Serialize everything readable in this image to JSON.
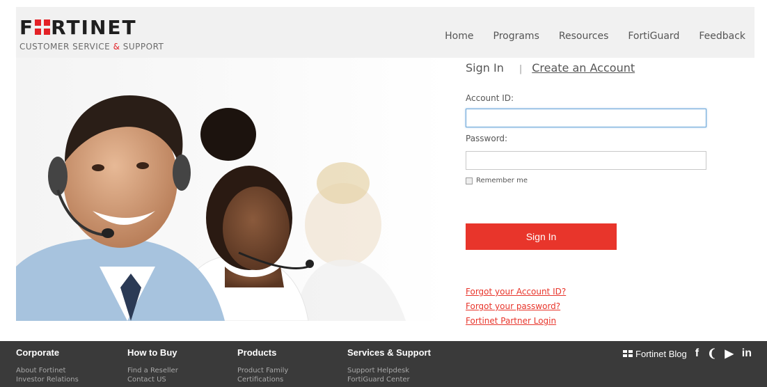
{
  "brand": {
    "logo_pre": "F",
    "logo_post": "RTINET",
    "tagline_a": "CUSTOMER SERVICE",
    "tagline_amp": "&",
    "tagline_b": "SUPPORT"
  },
  "nav": [
    "Home",
    "Programs",
    "Resources",
    "FortiGuard",
    "Feedback"
  ],
  "signin": {
    "tab_active": "Sign In",
    "separator": "|",
    "tab_create": "Create an Account",
    "account_label": "Account ID:",
    "account_value": "",
    "password_label": "Password:",
    "password_value": "",
    "remember_label": "Remember me",
    "button_label": "Sign In",
    "links": [
      "Forgot your Account ID?",
      "Forgot your password?",
      "Fortinet Partner Login"
    ]
  },
  "footer": {
    "columns": [
      {
        "title": "Corporate",
        "items": [
          "About Fortinet",
          "Investor Relations"
        ]
      },
      {
        "title": "How to Buy",
        "items": [
          "Find a Reseller",
          "Contact US"
        ]
      },
      {
        "title": "Products",
        "items": [
          "Product Family",
          "Certifications"
        ]
      },
      {
        "title": "Services & Support",
        "items": [
          "Support Helpdesk",
          "FortiGuard Center"
        ]
      }
    ],
    "blog_label": "Fortinet Blog",
    "social_icons": [
      "facebook-icon",
      "twitter-icon",
      "youtube-icon",
      "linkedin-icon"
    ],
    "social_glyphs": [
      "f",
      "❨",
      "▶",
      "in"
    ]
  },
  "colors": {
    "accent": "#e8352b",
    "footer_bg": "#3a3a3a",
    "header_bg": "#f1f1f1"
  }
}
